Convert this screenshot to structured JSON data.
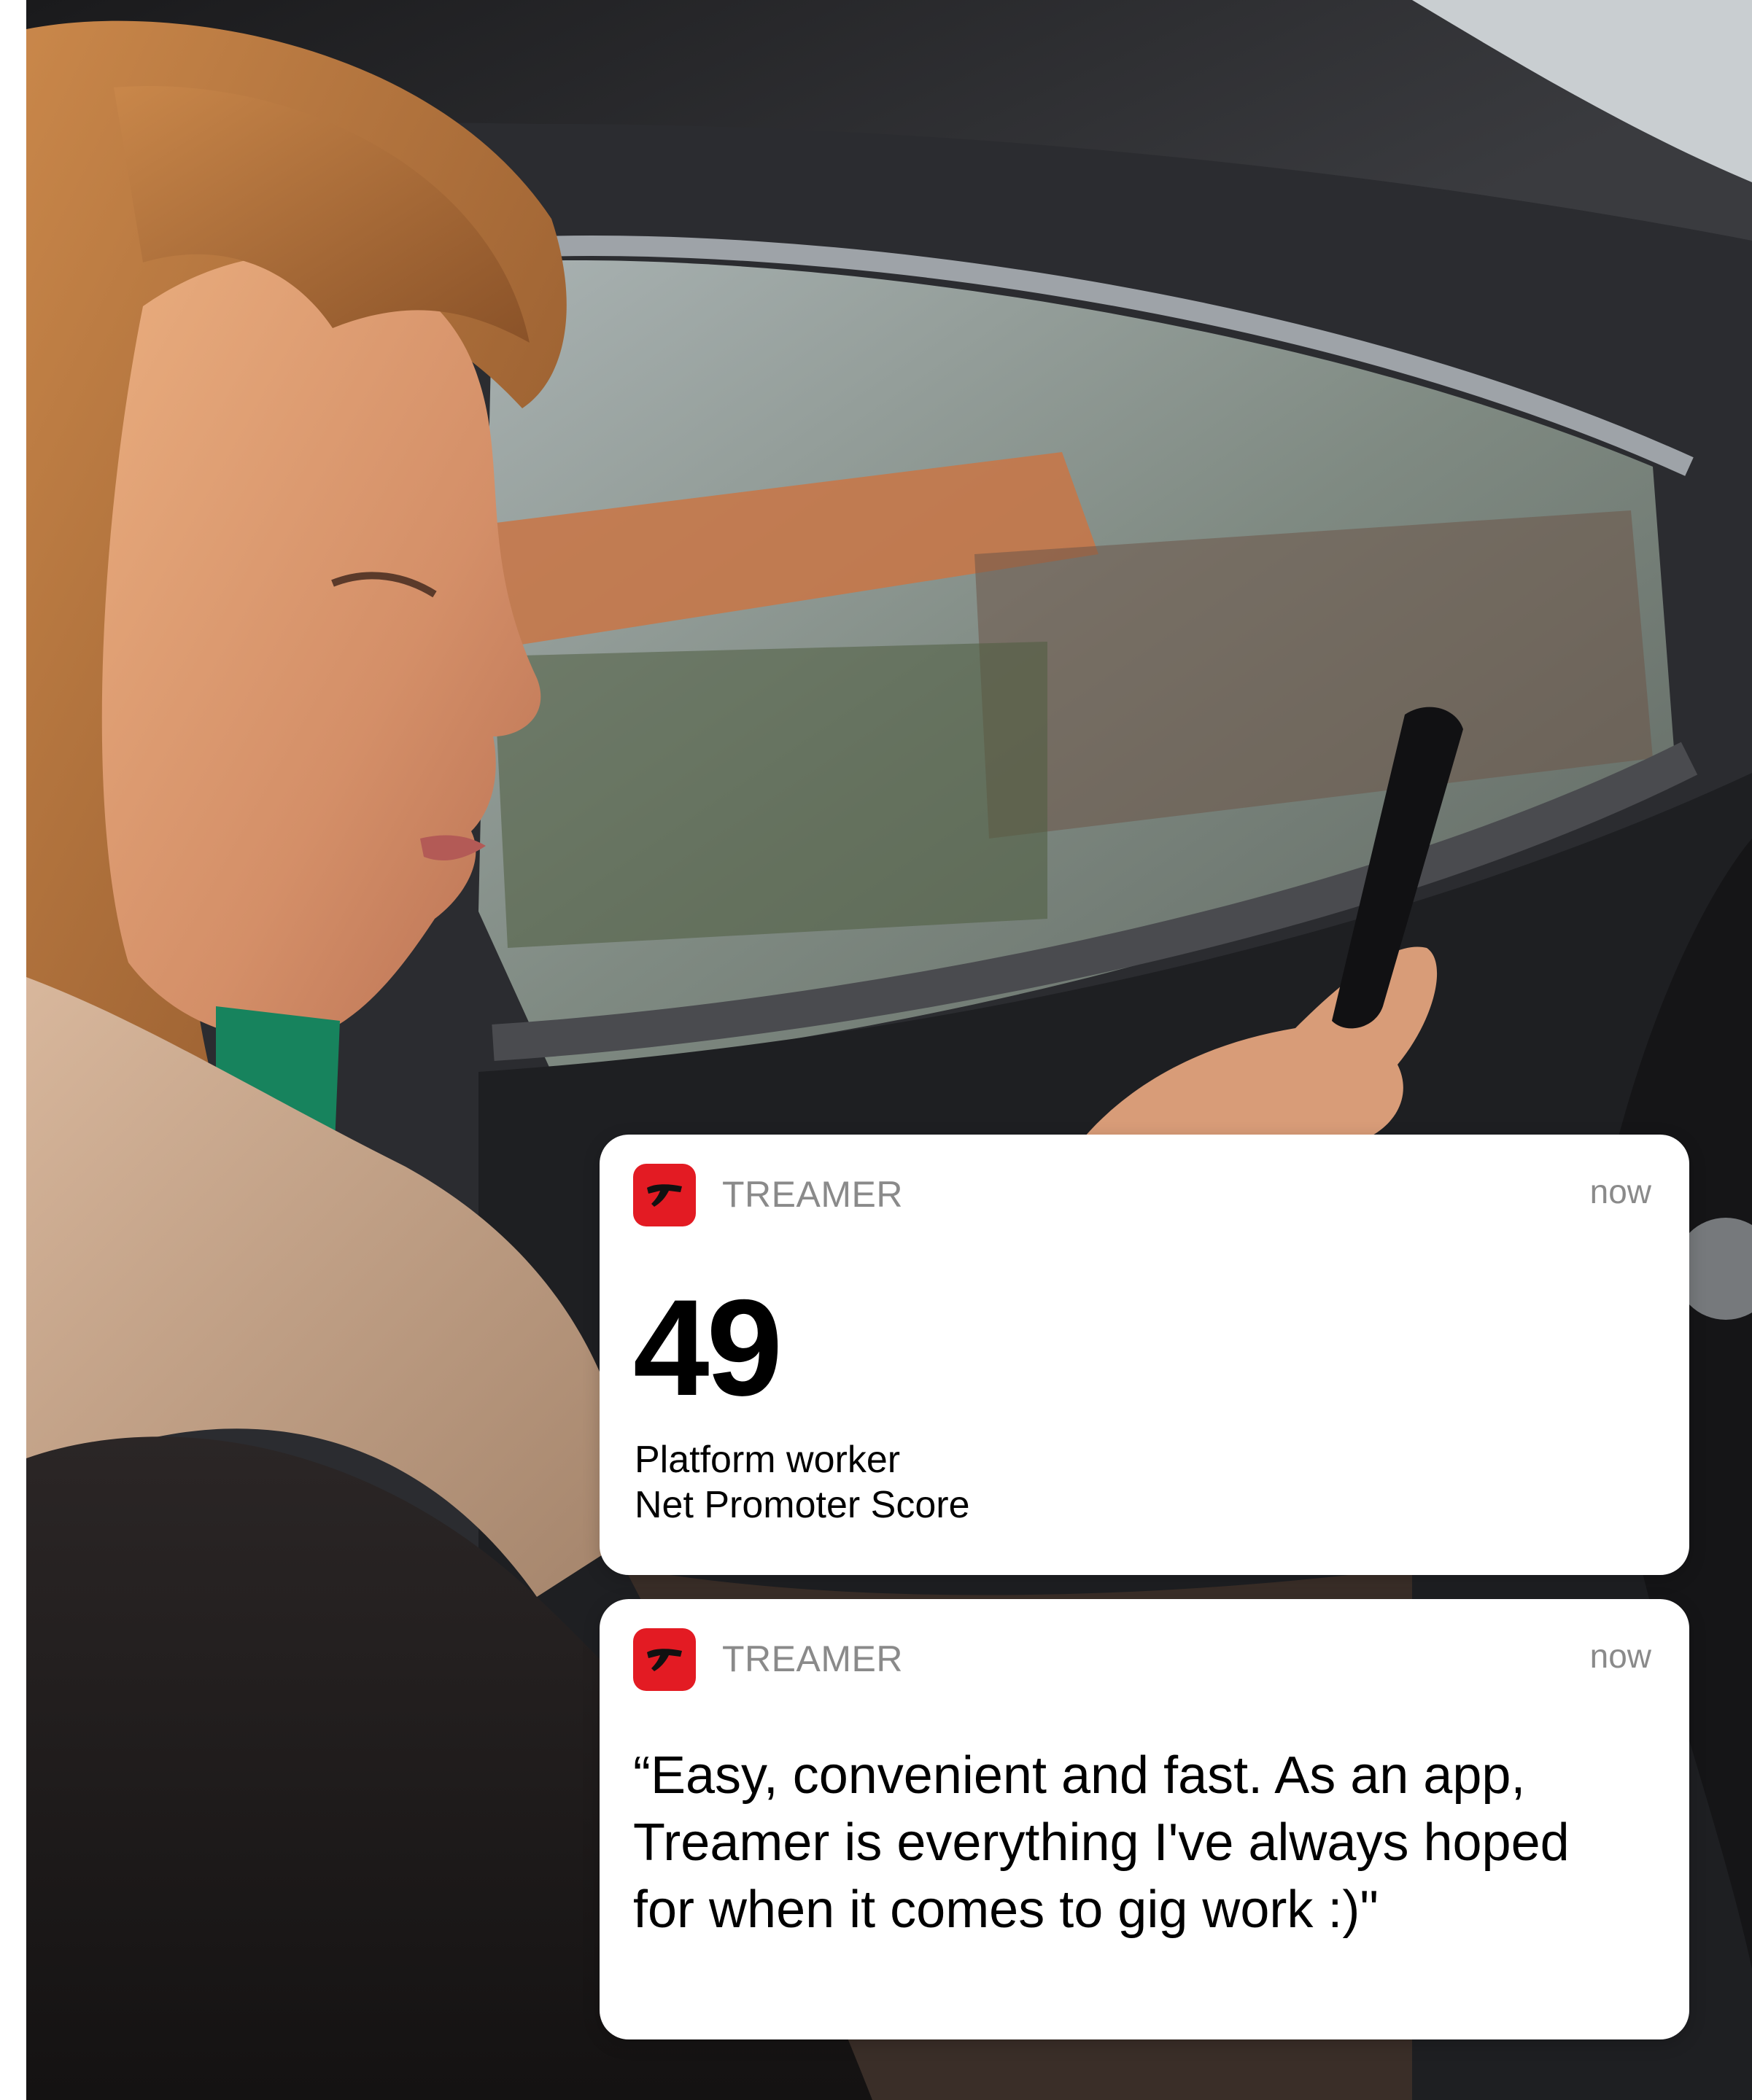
{
  "notifications": [
    {
      "app_name": "TREAMER",
      "timestamp": "now",
      "score": "49",
      "label_line_1": "Platform worker",
      "label_line_2": "Net Promoter Score"
    },
    {
      "app_name": "TREAMER",
      "timestamp": "now",
      "quote": "“Easy, convenient and fast. As an app,\nTreamer is everything I've always hoped\nfor when it comes to gig work :)\""
    }
  ],
  "icons": {
    "app_icon": "treamer-logo-icon"
  },
  "colors": {
    "brand_red": "#e31b23",
    "meta_gray": "#8a8a8a",
    "card_bg": "#ffffff"
  }
}
